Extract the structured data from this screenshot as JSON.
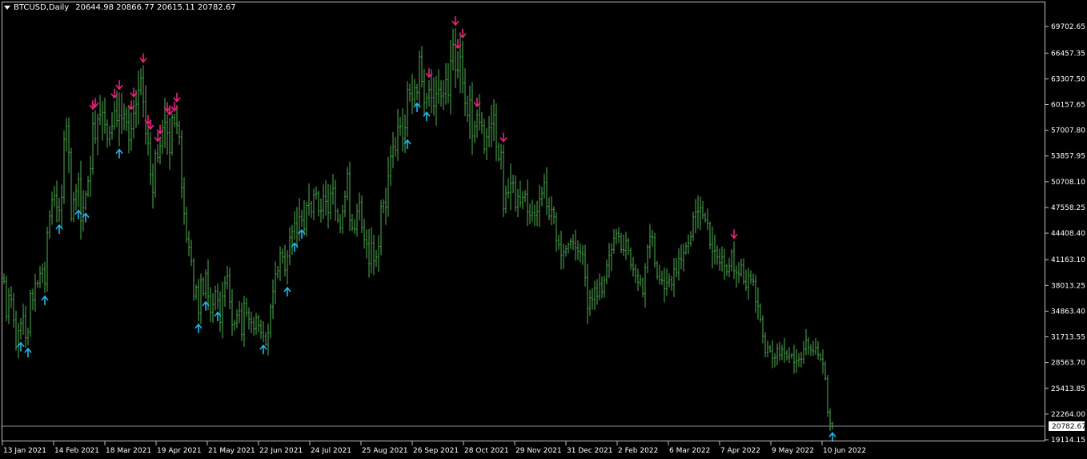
{
  "header": {
    "symbol": "BTCUSD,Daily",
    "ohlc": "20644.98 20866.77 20615.11 20782.67"
  },
  "colors": {
    "background": "#000000",
    "bars": "#4caf50",
    "buy_arrow": "#1fb6e8",
    "sell_arrow": "#e8237d",
    "price_line": "#7f8c9a",
    "axis": "#c0c0c0",
    "text": "#ffffff"
  },
  "icons": {
    "buy": "arrow-up-icon",
    "sell": "arrow-down-icon",
    "menu": "triangle-down-icon"
  },
  "chart_data": {
    "type": "bar",
    "title": "BTCUSD,Daily",
    "last_price": 20782.67,
    "last_price_label": "20782.67",
    "ylim": [
      19114.15,
      70800
    ],
    "y_ticks": [
      69702.65,
      66457.35,
      63307.5,
      60157.65,
      57007.8,
      53857.95,
      50708.1,
      47558.25,
      44408.4,
      41163.1,
      38013.25,
      34863.4,
      31713.55,
      28563.7,
      25413.85,
      22264.0,
      19114.15
    ],
    "y_tick_labels": [
      "69702.65",
      "66457.35",
      "63307.50",
      "60157.65",
      "57007.80",
      "53857.95",
      "50708.10",
      "47558.25",
      "44408.40",
      "41163.10",
      "38013.25",
      "34863.40",
      "31713.55",
      "28563.70",
      "25413.85",
      "22264.00",
      "19114.15"
    ],
    "x_ticks": [
      "13 Jan 2021",
      "14 Feb 2021",
      "18 Mar 2021",
      "19 Apr 2021",
      "21 May 2021",
      "22 Jun 2021",
      "24 Jul 2021",
      "25 Aug 2021",
      "26 Sep 2021",
      "28 Oct 2021",
      "29 Nov 2021",
      "31 Dec 2021",
      "2 Feb 2022",
      "6 Mar 2022",
      "7 Apr 2022",
      "9 May 2022",
      "10 Jun 2022"
    ],
    "grid": false,
    "series": [
      {
        "close": [
          38500,
          34200,
          36800,
          36300,
          33800,
          30500,
          32500,
          33400,
          34300,
          31600,
          32300,
          37000,
          36200,
          38200,
          38300,
          39500,
          40000,
          38200,
          44500,
          46500,
          48500,
          49000,
          47600,
          47200,
          48800,
          55900,
          57500,
          54300,
          46200,
          48500,
          49600,
          51000,
          45900,
          47500,
          49200,
          50800,
          52300,
          57800,
          56000,
          58400,
          58900,
          59200,
          57700,
          55900,
          56700,
          57500,
          59400,
          58200,
          58800,
          58500,
          59000,
          58000,
          55800,
          57200,
          59100,
          60200,
          61900,
          63400,
          60500,
          56600,
          55400,
          51600,
          49400,
          54200,
          53700,
          55100,
          57300,
          58000,
          56700,
          54300,
          58600,
          57800,
          57600,
          56200,
          50000,
          46800,
          43700,
          42700,
          41000,
          36700,
          37800,
          34600,
          38700,
          37000,
          39500,
          36700,
          34700,
          35700,
          37300,
          36200,
          33500,
          36700,
          38300,
          39200,
          36000,
          33200,
          33400,
          34400,
          34900,
          32000,
          35800,
          34700,
          33900,
          33500,
          32700,
          34100,
          33100,
          32200,
          31800,
          30800,
          32200,
          35400,
          37300,
          39400,
          39800,
          42000,
          41500,
          39900,
          41600,
          43900,
          44600,
          45600,
          44500,
          46400,
          46000,
          44900,
          47800,
          48000,
          47000,
          49100,
          49300,
          47100,
          47200,
          48900,
          48300,
          46900,
          49300,
          49900,
          47100,
          46000,
          45000,
          47100,
          48900,
          51700,
          46000,
          45000,
          44900,
          47100,
          48200,
          45100,
          43600,
          43100,
          40700,
          43200,
          41000,
          41500,
          42800,
          47700,
          48200,
          47600,
          51400,
          53800,
          55000,
          54600,
          57400,
          57500,
          56000,
          57300,
          62000,
          61500,
          60800,
          62200,
          61600,
          66000,
          63000,
          60400,
          61000,
          62000,
          61000,
          60000,
          61500,
          62000,
          61200,
          61500,
          63200,
          61300,
          65500,
          67500,
          64400,
          64300,
          66000,
          62800,
          60300,
          58800,
          60700,
          56300,
          57500,
          58900,
          58000,
          57600,
          54700,
          56200,
          57300,
          57800,
          58900,
          55000,
          53500,
          54300,
          47400,
          49300,
          49400,
          50500,
          50600,
          47600,
          48900,
          48200,
          48800,
          49200,
          47000,
          46600,
          46900,
          46600,
          47100,
          48600,
          49300,
          50600,
          47700,
          46500,
          47300,
          46400,
          43500,
          43000,
          41700,
          42100,
          42500,
          43000,
          43400,
          43200,
          42600,
          42200,
          42000,
          41800,
          39000,
          35200,
          36500,
          36300,
          37700,
          36700,
          38200,
          37200,
          38700,
          40500,
          41700,
          42400,
          43800,
          44400,
          44000,
          42400,
          42300,
          43500,
          42300,
          40500,
          40000,
          39200,
          38400,
          38700,
          37000,
          40200,
          42700,
          44000,
          43900,
          40700,
          39100,
          38700,
          38600,
          37600,
          38400,
          38700,
          38100,
          40000,
          39600,
          41300,
          41100,
          42000,
          42800,
          43200,
          44000,
          46400,
          47000,
          47100,
          47500,
          46600,
          46000,
          45600,
          43000,
          42200,
          42300,
          41500,
          40800,
          41500,
          40400,
          39700,
          40400,
          42100,
          39800,
          39600,
          39400,
          40500,
          38500,
          37800,
          39200,
          38700,
          38500,
          36000,
          35500,
          33900,
          31800,
          29800,
          30400,
          30000,
          29100,
          29200,
          30300,
          29500,
          30200,
          29700,
          29200,
          29400,
          29500,
          28600,
          28800,
          29000,
          29000,
          30200,
          31300,
          30400,
          30100,
          29900,
          30400,
          29500,
          29000,
          28400,
          26600,
          22500,
          21100,
          20782.67
        ]
      }
    ],
    "signals": {
      "buy_bar_index": [
        7,
        10,
        17,
        23,
        31,
        34,
        48,
        81,
        84,
        89,
        108,
        118,
        121,
        124,
        168,
        172,
        176,
        345
      ],
      "sell_bar_index": [
        37,
        38,
        46,
        48,
        53,
        54,
        58,
        60,
        61,
        64,
        65,
        68,
        69,
        71,
        72,
        177,
        188,
        189,
        191,
        197,
        208,
        304
      ]
    }
  }
}
